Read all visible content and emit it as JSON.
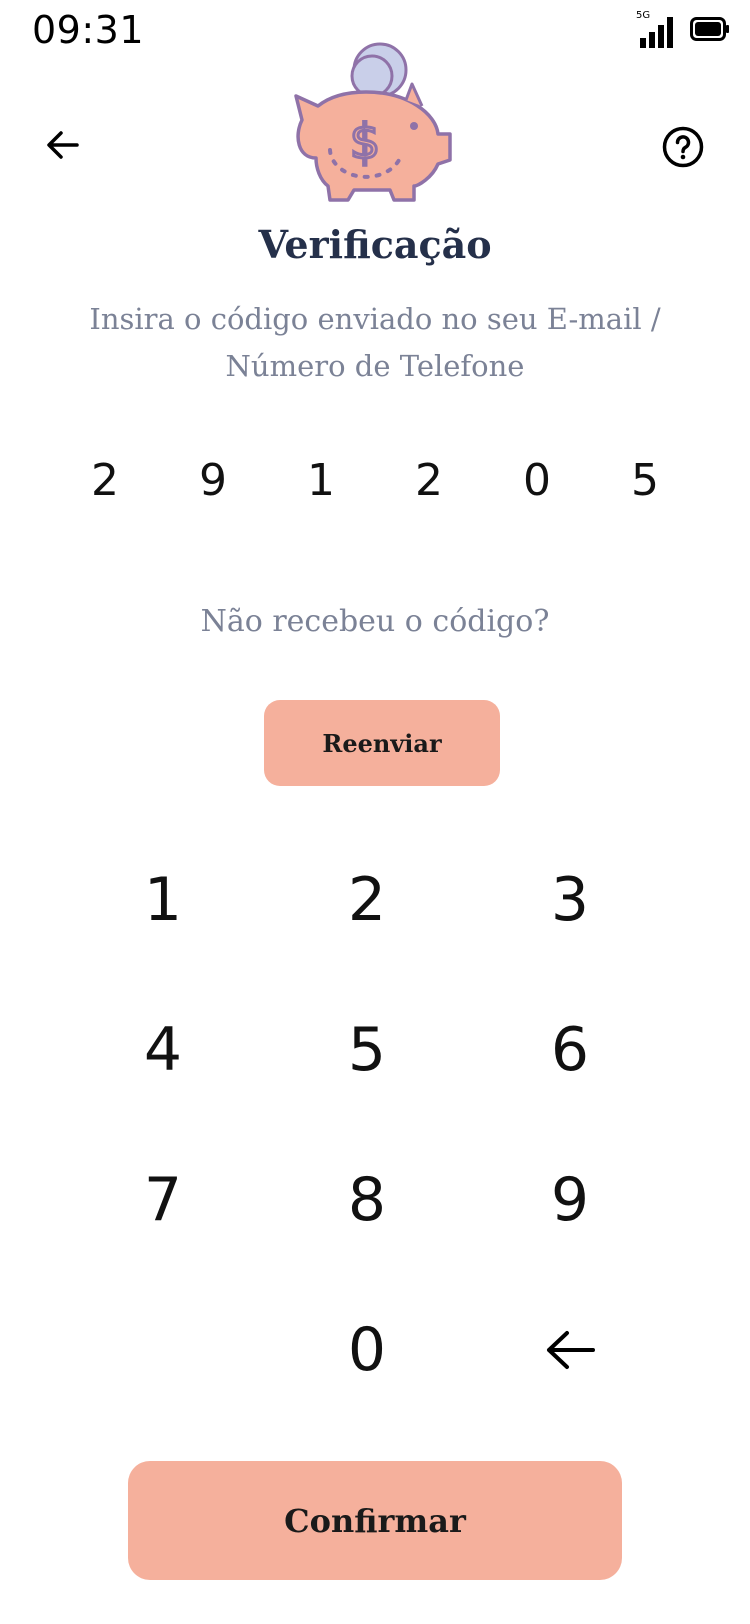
{
  "status_bar": {
    "time": "09:31",
    "network": "5G"
  },
  "header": {
    "back_icon": "arrow-left-icon",
    "help_icon": "question-circle-icon"
  },
  "mascot": {
    "icon": "piggy-bank-coin-icon",
    "colors": {
      "body": "#f5b09c",
      "outline": "#8f72a8",
      "coin": "#c9cfe9"
    }
  },
  "title": "Verificação",
  "subtitle_line1": "Insira o código enviado no seu E-mail /",
  "subtitle_line2": "Número de Telefone",
  "code": [
    "2",
    "9",
    "1",
    "2",
    "0",
    "5"
  ],
  "no_code_text": "Não recebeu o código?",
  "resend_label": "Reenviar",
  "keypad": {
    "keys": [
      "1",
      "2",
      "3",
      "4",
      "5",
      "6",
      "7",
      "8",
      "9",
      "0"
    ],
    "backspace_icon": "arrow-left-icon"
  },
  "confirm_label": "Confirmar",
  "colors": {
    "accent": "#f5b09c",
    "title": "#25304a",
    "muted_text": "#7b8296"
  }
}
